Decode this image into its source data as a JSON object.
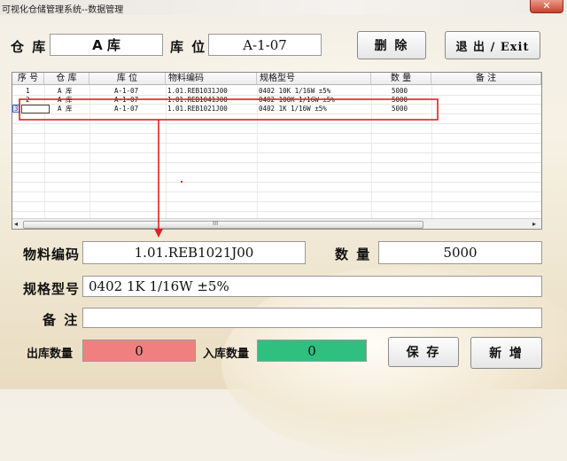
{
  "window": {
    "title": "可视化仓储管理系统--数据管理",
    "close_glyph": "✕"
  },
  "header": {
    "warehouse_label": "仓 库",
    "warehouse_value": "A 库",
    "location_label": "库 位",
    "location_value": "A-1-07",
    "delete_label": "删 除",
    "exit_label": "退 出 / Exit"
  },
  "table": {
    "columns": [
      "序 号",
      "仓 库",
      "库 位",
      "物料编码",
      "规格型号",
      "数 量",
      "备 注"
    ],
    "rows": [
      {
        "idx": "1",
        "warehouse": "A 库",
        "location": "A-1-07",
        "code": "1.01.REB1031J00",
        "spec": "0402 10K 1/16W ±5%",
        "qty": "5000",
        "note": ""
      },
      {
        "idx": "2",
        "warehouse": "A 库",
        "location": "A-1-07",
        "code": "1.01.REB1041J00",
        "spec": "0402 100K 1/16W ±5%",
        "qty": "5000",
        "note": ""
      },
      {
        "idx": "3",
        "warehouse": "A 库",
        "location": "A-1-07",
        "code": "1.01.REB1021J00",
        "spec": "0402 1K 1/16W ±5%",
        "qty": "5000",
        "note": ""
      }
    ],
    "scroll_grip": "III"
  },
  "detail": {
    "code_label": "物料编码",
    "code_value": "1.01.REB1021J00",
    "qty_label": "数 量",
    "qty_value": "5000",
    "spec_label": "规格型号",
    "spec_value": "0402 1K 1/16W ±5%",
    "note_label": "备 注",
    "note_value": ""
  },
  "footer": {
    "out_label": "出库数量",
    "out_value": "0",
    "in_label": "入库数量",
    "in_value": "0",
    "save_label": "保 存",
    "new_label": "新 增"
  },
  "colors": {
    "highlight": "#e02020",
    "out_bg": "#f08080",
    "in_bg": "#2fbf7f"
  }
}
